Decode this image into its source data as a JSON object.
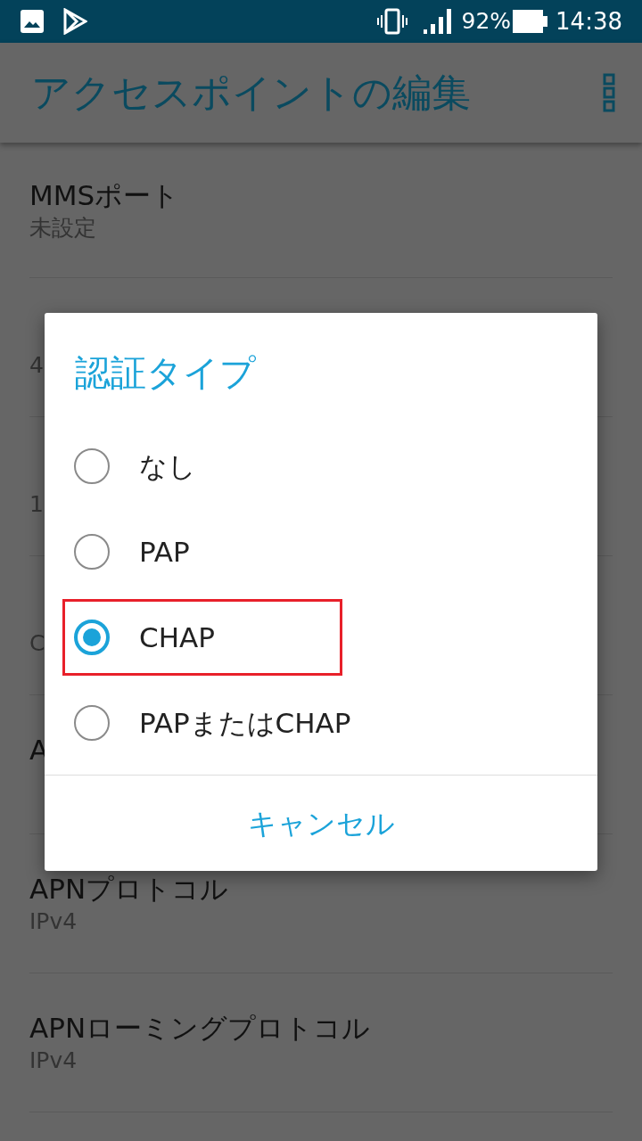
{
  "status_bar": {
    "battery": "92%",
    "time": "14:38"
  },
  "app_bar": {
    "title": "アクセスポイントの編集"
  },
  "settings": [
    {
      "title": "MMSポート",
      "value": "未設定"
    },
    {
      "value": "4"
    },
    {
      "value": "1"
    },
    {
      "value": "C"
    },
    {
      "title": "A"
    },
    {
      "title": "APNプロトコル",
      "value": "IPv4"
    },
    {
      "title": "APNローミングプロトコル",
      "value": "IPv4"
    }
  ],
  "dialog": {
    "title": "認証タイプ",
    "options": [
      {
        "label": "なし",
        "selected": false,
        "highlighted": false
      },
      {
        "label": "PAP",
        "selected": false,
        "highlighted": false
      },
      {
        "label": "CHAP",
        "selected": true,
        "highlighted": true
      },
      {
        "label": "PAPまたはCHAP",
        "selected": false,
        "highlighted": false
      }
    ],
    "cancel": "キャンセル"
  }
}
